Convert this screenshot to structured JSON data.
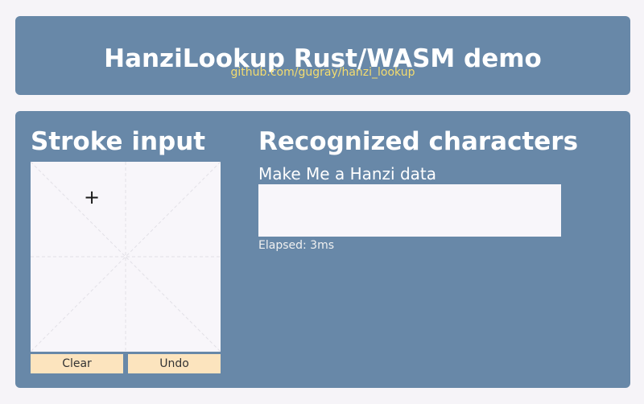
{
  "header": {
    "title": "HanziLookup Rust/WASM demo",
    "link_text": "github.com/gugray/hanzi_lookup"
  },
  "stroke_input": {
    "title": "Stroke input",
    "cursor_icon": "crosshair-cursor-icon",
    "clear_label": "Clear",
    "undo_label": "Undo"
  },
  "recognized": {
    "title": "Recognized characters",
    "data_label": "Make Me a Hanzi data",
    "elapsed_text": "Elapsed: 3ms"
  },
  "colors": {
    "background": "#f6f4f8",
    "panel": "#6888a8",
    "link": "#f4dc6e",
    "button": "#fce4be"
  }
}
